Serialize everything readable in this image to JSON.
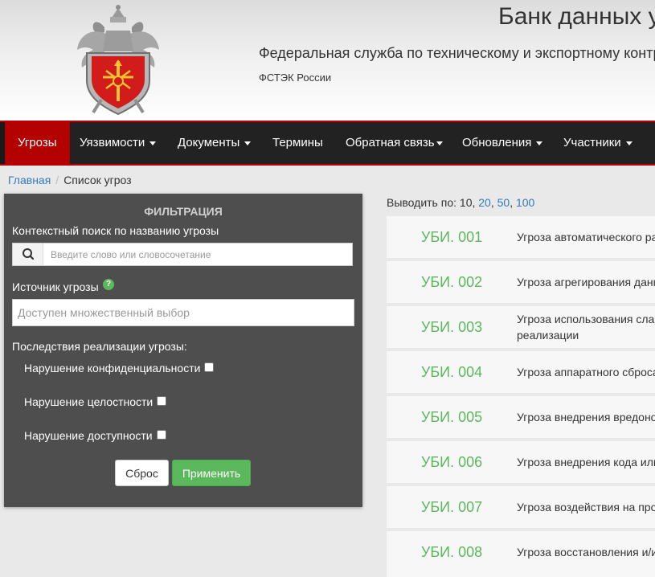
{
  "header": {
    "site_title": "Банк данных у",
    "org_name": "Федеральная служба по техническому и экспортному контр",
    "org_short": "ФСТЭК России"
  },
  "nav": {
    "items": [
      {
        "label": "Угрозы",
        "dropdown": false,
        "active": true
      },
      {
        "label": "Уязвимости",
        "dropdown": true
      },
      {
        "label": "Документы",
        "dropdown": true
      },
      {
        "label": "Термины",
        "dropdown": false
      },
      {
        "label": "Обратная связь",
        "dropdown": true
      },
      {
        "label": "Обновления",
        "dropdown": true
      },
      {
        "label": "Участники",
        "dropdown": true
      }
    ]
  },
  "breadcrumb": {
    "home": "Главная",
    "separator": "/",
    "current": "Список угроз"
  },
  "filter": {
    "title": "ФИЛЬТРАЦИЯ",
    "search_label": "Контекстный поиск по названию угрозы",
    "search_placeholder": "Введите слово или словосочетание",
    "source_label": "Источник угрозы",
    "source_placeholder": "Доступен множественный выбор",
    "consequences_label": "Последствия реализации угрозы:",
    "checkboxes": [
      {
        "label": "Нарушение конфиденциальности",
        "checked": false
      },
      {
        "label": "Нарушение целостности",
        "checked": false
      },
      {
        "label": "Нарушение доступности",
        "checked": false
      }
    ],
    "reset_label": "Сброс",
    "apply_label": "Применить"
  },
  "results": {
    "per_page_label": "Выводить по:",
    "per_page_current": "10",
    "per_page_options": [
      "20",
      "50",
      "100"
    ],
    "threats": [
      {
        "id": "УБИ. 001",
        "name": "Угроза автоматического ра"
      },
      {
        "id": "УБИ. 002",
        "name": "Угроза агрегирования данн"
      },
      {
        "id": "УБИ. 003",
        "name_line1": "Угроза использования слаб",
        "name_line2": "реализации"
      },
      {
        "id": "УБИ. 004",
        "name": "Угроза аппаратного сброса"
      },
      {
        "id": "УБИ. 005",
        "name": "Угроза внедрения вредонос"
      },
      {
        "id": "УБИ. 006",
        "name": "Угроза внедрения кода или"
      },
      {
        "id": "УБИ. 007",
        "name": "Угроза воздействия на про"
      },
      {
        "id": "УБИ. 008",
        "name": "Угроза восстановления и/и"
      }
    ]
  },
  "colors": {
    "accent_red": "#b30000",
    "nav_bg": "#222222",
    "link_blue": "#337ab7",
    "threat_green": "#5cb85c",
    "panel_bg": "#4e4e4e"
  }
}
